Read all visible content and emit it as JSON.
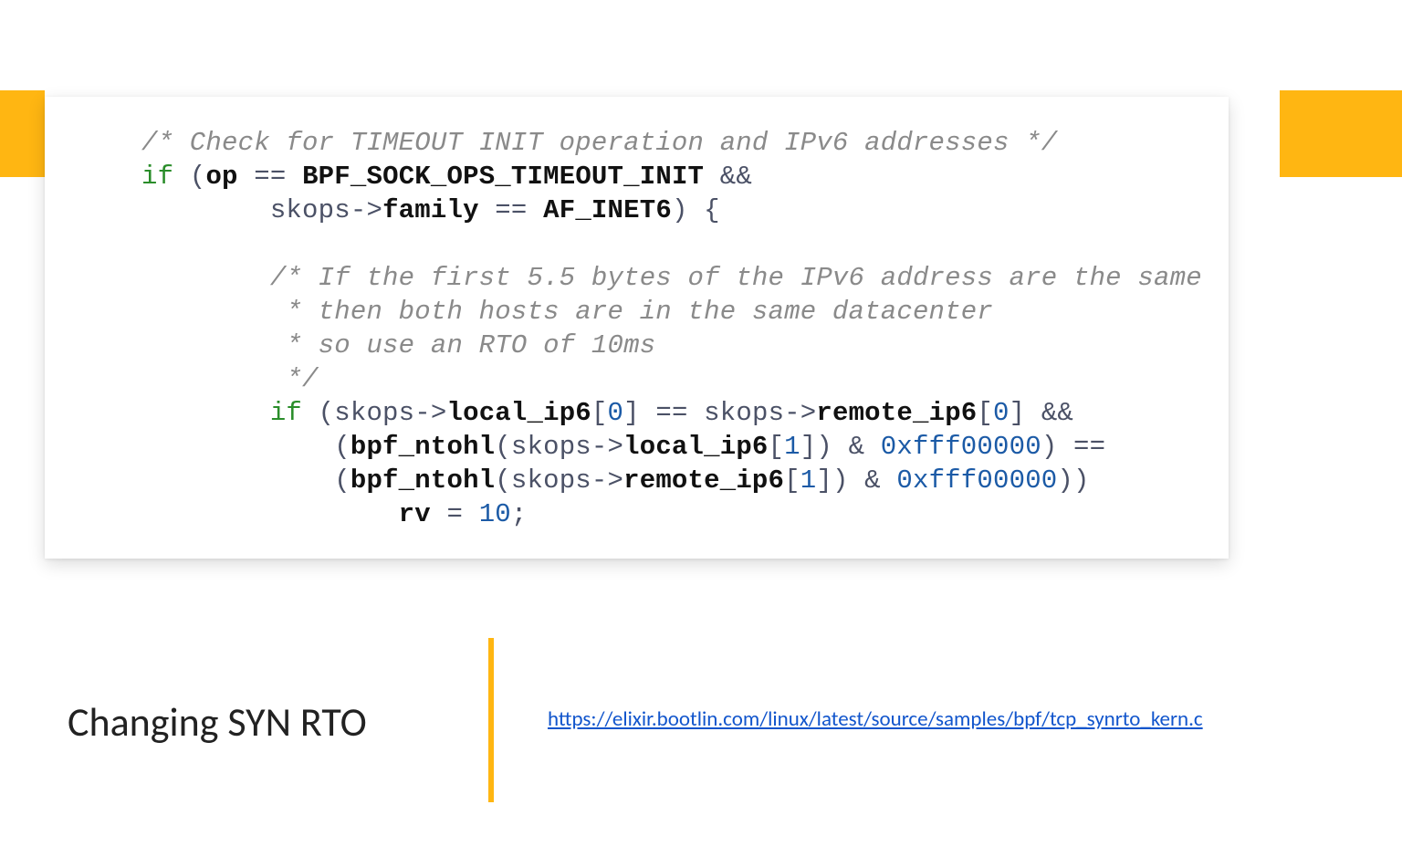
{
  "slide": {
    "title": "Changing SYN RTO",
    "link_text": "https://elixir.bootlin.com/linux/latest/source/samples/bpf/tcp_synrto_kern.c",
    "accent_color": "#ffb612",
    "link_color": "#1155cc"
  },
  "code": {
    "comment1": "/* Check for TIMEOUT INIT operation and IPv6 addresses */",
    "if1_kw": "if",
    "if1_open": " (",
    "op": "op",
    "eq1": " == ",
    "const1": "BPF_SOCK_OPS_TIMEOUT_INIT",
    "andand1": " &&",
    "line2_indent": "        ",
    "skops_arrow1": "skops->",
    "family": "family",
    "eq2": " == ",
    "afinet6": "AF_INET6",
    "close_brace_open": ") {",
    "blank": "",
    "c2l1_indent": "        ",
    "c2l1": "/* If the first 5.5 bytes of the IPv6 address are the same",
    "c2l2_indent": "         ",
    "c2l2": "* then both hosts are in the same datacenter",
    "c2l3_indent": "         ",
    "c2l3": "* so use an RTO of 10ms",
    "c2l4_indent": "         ",
    "c2l4": "*/",
    "if2_indent": "        ",
    "if2_kw": "if",
    "if2_open": " (skops->",
    "localip6_a": "local_ip6",
    "idx0a": "[",
    "zero_a": "0",
    "idx0a_close": "] == skops->",
    "remoteip6_a": "remote_ip6",
    "idx0b": "[",
    "zero_b": "0",
    "idx0b_close": "] &&",
    "line9_indent": "            (",
    "bpfntohl1": "bpf_ntohl",
    "l9_mid1": "(skops->",
    "localip6_b": "local_ip6",
    "idx1a": "[",
    "one_a": "1",
    "idx1a_close": "]) & ",
    "mask1": "0xfff00000",
    "l9_end": ") ==",
    "line10_indent": "            (",
    "bpfntohl2": "bpf_ntohl",
    "l10_mid1": "(skops->",
    "remoteip6_b": "remote_ip6",
    "idx1b": "[",
    "one_b": "1",
    "idx1b_close": "]) & ",
    "mask2": "0xfff00000",
    "l10_end": "))",
    "line11_indent": "                ",
    "rv": "rv",
    "assign": " = ",
    "ten": "10",
    "semi": ";"
  }
}
